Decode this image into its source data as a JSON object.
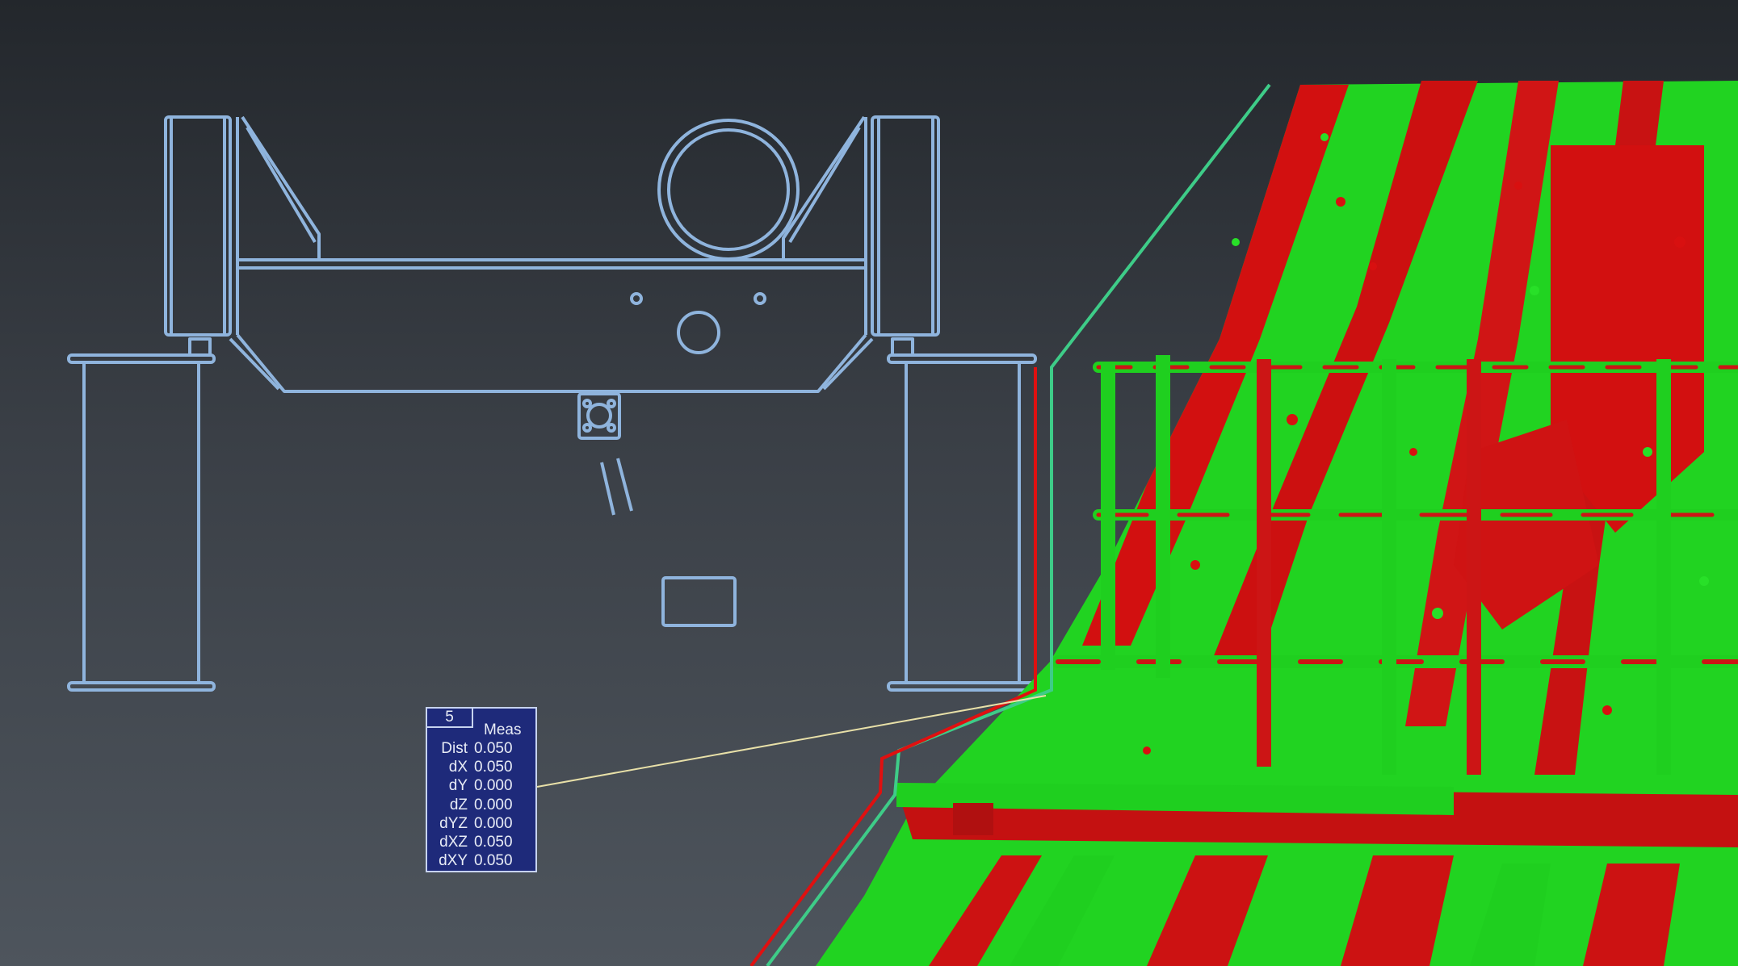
{
  "measurement": {
    "id": "5",
    "header": "Meas",
    "rows": [
      {
        "label": "Dist",
        "value": "0.050"
      },
      {
        "label": "dX",
        "value": "0.050"
      },
      {
        "label": "dY",
        "value": "0.000"
      },
      {
        "label": "dZ",
        "value": "0.000"
      },
      {
        "label": "dYZ",
        "value": "0.000"
      },
      {
        "label": "dXZ",
        "value": "0.050"
      },
      {
        "label": "dXY",
        "value": "0.050"
      }
    ]
  },
  "colors": {
    "background_top": "#23272c",
    "background_bottom": "#4e555d",
    "cad_line": "#8fb4dd",
    "pointcloud_green": "#22dd22",
    "pointcloud_red": "#dd1111",
    "measure_line": "#e8e0a8",
    "section_green": "#3ecc88",
    "section_red": "#e01010",
    "label_bg": "#1e2a7a",
    "label_border": "#c7d3ef"
  }
}
